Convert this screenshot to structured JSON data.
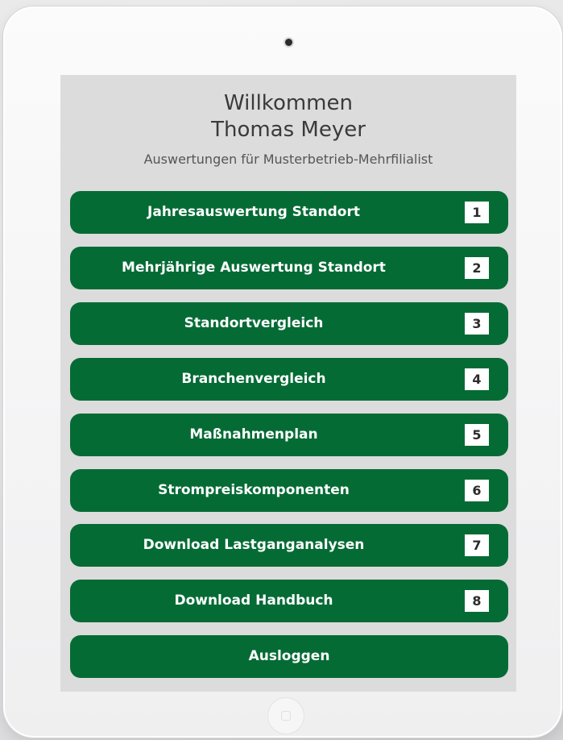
{
  "welcome": {
    "greeting": "Willkommen",
    "user_name": "Thomas Meyer",
    "subtitle": "Auswertungen für Musterbetrieb-Mehrfilialist"
  },
  "menu": [
    {
      "label": "Jahresauswertung Standort",
      "number": "1"
    },
    {
      "label": "Mehrjährige Auswertung Standort",
      "number": "2"
    },
    {
      "label": "Standortvergleich",
      "number": "3"
    },
    {
      "label": "Branchenvergleich",
      "number": "4"
    },
    {
      "label": "Maßnahmenplan",
      "number": "5"
    },
    {
      "label": "Strompreiskomponenten",
      "number": "6"
    },
    {
      "label": "Download Lastganganalysen",
      "number": "7"
    },
    {
      "label": "Download Handbuch",
      "number": "8"
    }
  ],
  "logout": {
    "label": "Ausloggen"
  },
  "colors": {
    "button_green": "#056b35",
    "screen_background": "#dcdcdc",
    "badge_background": "#ffffff"
  },
  "icons": {
    "camera": "camera-icon",
    "home": "home-button-icon"
  }
}
